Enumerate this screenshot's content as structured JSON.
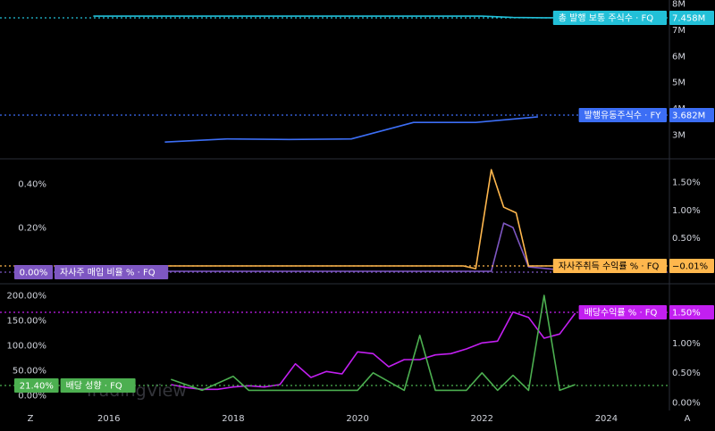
{
  "panes": [
    {
      "id": "shares",
      "right_axis_ticks": [
        "8M",
        "7M",
        "6M",
        "5M",
        "4M",
        "3M"
      ],
      "right_axis_range": [
        2.5,
        8
      ],
      "series": [
        {
          "name": "총 발행 보통 주식수 · FQ",
          "value_label": "7.458M",
          "color": "#22c0d8",
          "x": [
            2015.75,
            2016.5,
            2017.5,
            2018.5,
            2019.5,
            2020.5,
            2021.5,
            2022.0,
            2022.5,
            2023.0,
            2023.5
          ],
          "y": [
            7.52,
            7.52,
            7.52,
            7.52,
            7.52,
            7.52,
            7.52,
            7.52,
            7.47,
            7.458,
            7.458
          ]
        },
        {
          "name": "발행유동주식수 · FY",
          "value_label": "3.682M",
          "color": "#3c6ef5",
          "x": [
            2016.9,
            2017.9,
            2018.9,
            2019.9,
            2020.9,
            2021.9,
            2022.9
          ],
          "y": [
            2.72,
            2.84,
            2.82,
            2.84,
            3.47,
            3.47,
            3.682
          ]
        }
      ]
    },
    {
      "id": "yields",
      "left_axis_ticks": [
        "0.40%",
        "0.20%"
      ],
      "left_axis_range": [
        0,
        0.5
      ],
      "right_axis_ticks": [
        "1.50%",
        "1.00%",
        "0.50%"
      ],
      "right_axis_range": [
        -0.05,
        1.85
      ],
      "series": [
        {
          "name": "자사주 매입 비율 % · FQ",
          "value_label": "0.00%",
          "color": "#7e57c2",
          "axis": "left",
          "x": [
            2016.9,
            2021.8,
            2021.9,
            2022.15,
            2022.35,
            2022.5,
            2022.75,
            2023.5
          ],
          "y": [
            0,
            0,
            0,
            0,
            0.22,
            0.2,
            0.02,
            0.0
          ]
        },
        {
          "name": "자사주취득 수익률 % · FQ",
          "value_label": "−0.01%",
          "color": "#ffb74d",
          "axis": "right",
          "x": [
            2016.9,
            2021.7,
            2021.9,
            2022.15,
            2022.35,
            2022.55,
            2022.75,
            2023.5
          ],
          "y": [
            0.0,
            0.0,
            -0.05,
            1.72,
            1.05,
            0.95,
            0.0,
            0.0
          ]
        }
      ]
    },
    {
      "id": "dividends",
      "left_axis_ticks": [
        "200.00%",
        "150.00%",
        "100.00%",
        "50.00%",
        "0.00%"
      ],
      "left_axis_range": [
        0,
        215
      ],
      "right_axis_ticks": [
        "1.50%",
        "1.00%",
        "0.50%",
        "0.00%"
      ],
      "right_axis_range": [
        0,
        1.6
      ],
      "series": [
        {
          "name": "배당수익률 % · FQ",
          "value_label": "1.50%",
          "color": "#c21ff0",
          "axis": "right",
          "x": [
            2017,
            2017.25,
            2017.5,
            2017.75,
            2018,
            2018.25,
            2018.5,
            2018.75,
            2019,
            2019.25,
            2019.5,
            2019.75,
            2020,
            2020.25,
            2020.5,
            2020.75,
            2021,
            2021.25,
            2021.5,
            2021.75,
            2022,
            2022.25,
            2022.5,
            2022.75,
            2023,
            2023.25,
            2023.5
          ],
          "y": [
            0.3,
            0.25,
            0.22,
            0.22,
            0.26,
            0.28,
            0.26,
            0.3,
            0.65,
            0.42,
            0.52,
            0.48,
            0.85,
            0.82,
            0.6,
            0.72,
            0.72,
            0.8,
            0.82,
            0.9,
            1.0,
            1.03,
            1.52,
            1.43,
            1.08,
            1.15,
            1.5
          ]
        },
        {
          "name": "배당 성향 · FQ",
          "value_label": "21.40%",
          "color": "#4caf50",
          "axis": "left",
          "x": [
            2017,
            2017.5,
            2018,
            2018.25,
            2018.5,
            2019,
            2019.5,
            2020,
            2020.25,
            2020.75,
            2021,
            2021.25,
            2021.5,
            2021.75,
            2022,
            2022.25,
            2022.5,
            2022.75,
            2023,
            2023.25,
            2023.5
          ],
          "y": [
            32,
            10,
            38,
            10,
            10,
            10,
            10,
            10,
            45,
            10,
            120,
            10,
            10,
            10,
            45,
            10,
            40,
            10,
            200,
            10,
            21.4
          ]
        }
      ]
    }
  ],
  "x_axis": {
    "ticks": [
      "2016",
      "2018",
      "2020",
      "2022",
      "2024"
    ],
    "range": [
      2014.25,
      2025.0
    ]
  },
  "corner_left": "Z",
  "corner_right": "A",
  "watermark": "TradingView",
  "colors": {
    "background": "#000000",
    "separator": "#2a2e39",
    "axis_text": "#d1d4dc"
  }
}
